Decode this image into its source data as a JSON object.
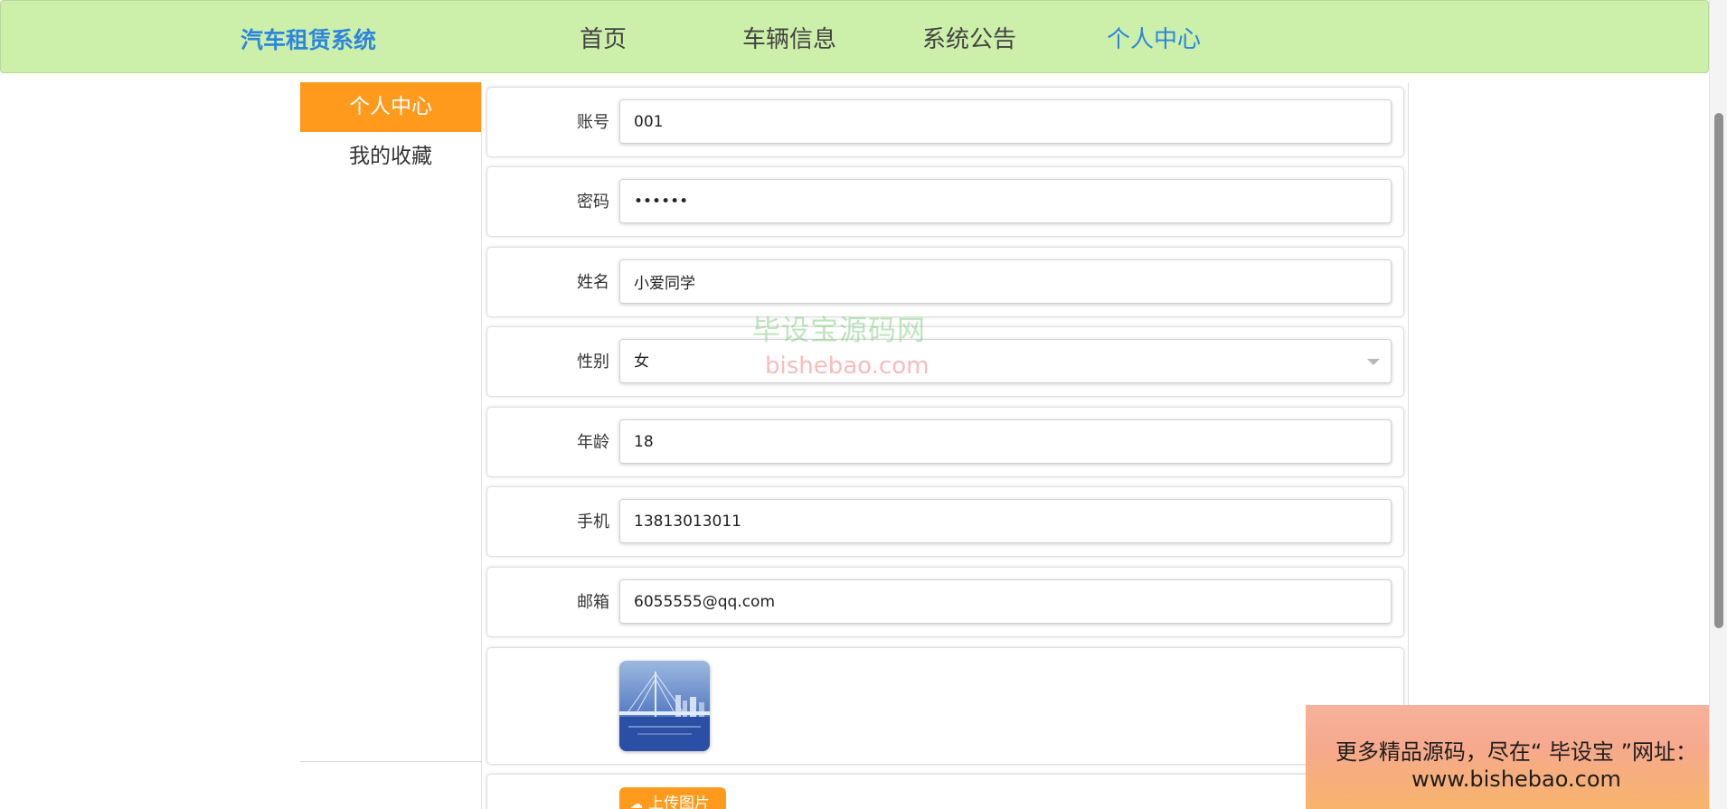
{
  "header": {
    "brand": "汽车租赁系统",
    "nav": [
      {
        "label": "首页",
        "active": false
      },
      {
        "label": "车辆信息",
        "active": false
      },
      {
        "label": "系统公告",
        "active": false
      },
      {
        "label": "个人中心",
        "active": true
      }
    ]
  },
  "sidebar": {
    "items": [
      {
        "label": "个人中心",
        "active": true
      },
      {
        "label": "我的收藏",
        "active": false
      }
    ]
  },
  "form": {
    "account": {
      "label": "账号",
      "value": "001"
    },
    "password": {
      "label": "密码",
      "value": "••••••"
    },
    "name": {
      "label": "姓名",
      "value": "小爱同学"
    },
    "gender": {
      "label": "性别",
      "value": "女"
    },
    "age": {
      "label": "年龄",
      "value": "18"
    },
    "phone": {
      "label": "手机",
      "value": "13813013011"
    },
    "email": {
      "label": "邮箱",
      "value": "6055555@qq.com"
    },
    "upload_label": "上传图片"
  },
  "watermark": {
    "cn": "毕设宝源码网",
    "en": "bishebao.com"
  },
  "promo": {
    "line1": "更多精品源码，尽在“ 毕设宝 ”网址：",
    "line2": "www.bishebao.com"
  },
  "colors": {
    "header_bg": "#ccefa9",
    "brand": "#2d86de",
    "active_nav": "#2b86e0",
    "sidebar_active": "#ff9a1c",
    "upload_button": "#ff9a1c"
  },
  "icons": {
    "select_arrow": "chevron-down-icon",
    "upload": "cloud-upload-icon"
  }
}
